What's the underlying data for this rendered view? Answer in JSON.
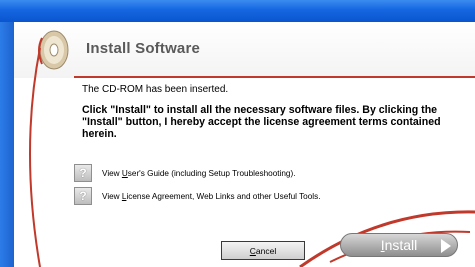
{
  "dialog": {
    "title": "Install Software",
    "status_text": "The CD-ROM has been inserted.",
    "instruction_text": "Click \"Install\" to install all the necessary software files.  By clicking the \"Install\" button, I hereby accept the license agreement terms contained herein.",
    "help_items": [
      {
        "icon": "?",
        "pre": "View ",
        "accel": "U",
        "post": "ser's Guide (including Setup Troubleshooting)."
      },
      {
        "icon": "?",
        "pre": "View ",
        "accel": "L",
        "post": "icense Agreement, Web Links and other Useful Tools."
      }
    ],
    "cancel_label_accel": "C",
    "cancel_label_rest": "ancel",
    "install_label_accel": "I",
    "install_label_rest": "nstall"
  },
  "colors": {
    "titlebar_blue": "#1566e0",
    "accent_red": "#c0392b",
    "install_gray": "#a8a8a8"
  }
}
